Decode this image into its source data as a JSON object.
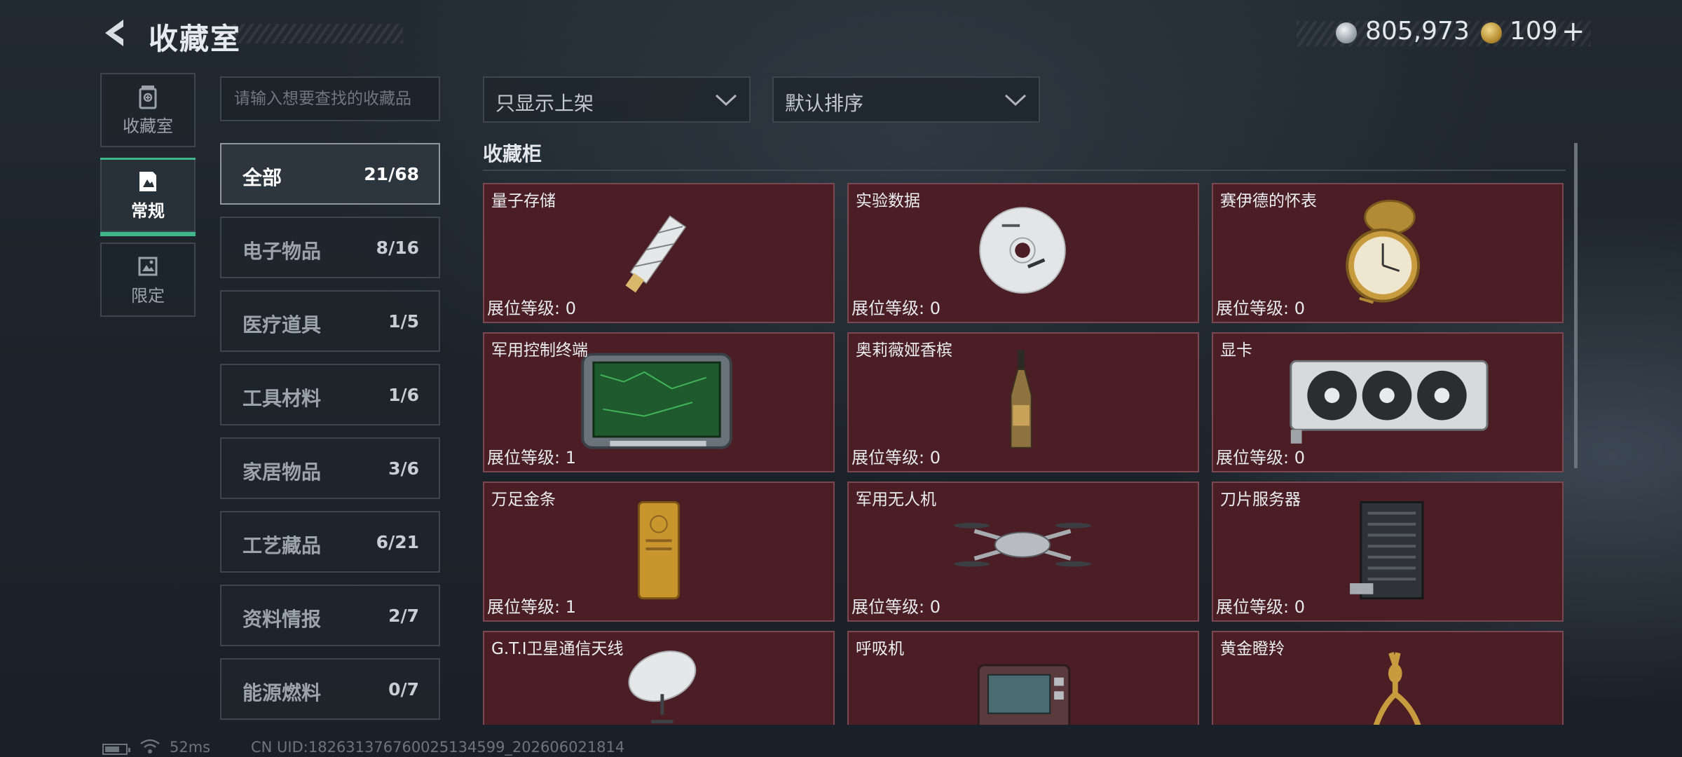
{
  "header": {
    "title": "收藏室",
    "currency": {
      "silver_value": "805,973",
      "gold_value": "109",
      "plus": "+"
    }
  },
  "side_tabs": [
    {
      "label": "收藏室",
      "icon": "trash-bin-icon"
    },
    {
      "label": "常规",
      "icon": "gallery-icon",
      "active": true
    },
    {
      "label": "限定",
      "icon": "landscape-icon"
    }
  ],
  "search": {
    "placeholder": "请输入想要查找的收藏品"
  },
  "categories": [
    {
      "name": "全部",
      "count": "21/68",
      "active": true
    },
    {
      "name": "电子物品",
      "count": "8/16"
    },
    {
      "name": "医疗道具",
      "count": "1/5"
    },
    {
      "name": "工具材料",
      "count": "1/6"
    },
    {
      "name": "家居物品",
      "count": "3/6"
    },
    {
      "name": "工艺藏品",
      "count": "6/21"
    },
    {
      "name": "资料情报",
      "count": "2/7"
    },
    {
      "name": "能源燃料",
      "count": "0/7"
    }
  ],
  "filters": {
    "display_filter": "只显示上架",
    "sort": "默认排序"
  },
  "section_title": "收藏柜",
  "level_prefix": "展位等级: ",
  "items": [
    {
      "name": "量子存储",
      "level": "展位等级: 0",
      "icon": "usb-drive-icon"
    },
    {
      "name": "实验数据",
      "level": "展位等级: 0",
      "icon": "disc-icon"
    },
    {
      "name": "赛伊德的怀表",
      "level": "展位等级: 0",
      "icon": "pocket-watch-icon"
    },
    {
      "name": "军用控制终端",
      "level": "展位等级: 1",
      "icon": "control-terminal-icon"
    },
    {
      "name": "奥莉薇娅香槟",
      "level": "展位等级: 0",
      "icon": "champagne-icon"
    },
    {
      "name": "显卡",
      "level": "展位等级: 0",
      "icon": "graphics-card-icon"
    },
    {
      "name": "万足金条",
      "level": "展位等级: 1",
      "icon": "gold-bar-icon"
    },
    {
      "name": "军用无人机",
      "level": "展位等级: 0",
      "icon": "drone-icon"
    },
    {
      "name": "刀片服务器",
      "level": "展位等级: 0",
      "icon": "server-icon"
    },
    {
      "name": "G.T.I卫星通信天线",
      "level": "",
      "icon": "satellite-dish-icon"
    },
    {
      "name": "呼吸机",
      "level": "",
      "icon": "ventilator-icon"
    },
    {
      "name": "黄金瞪羚",
      "level": "",
      "icon": "gazelle-statue-icon"
    }
  ],
  "status_bar": {
    "ping": "52ms",
    "uid": "CN UID:1826313767600251345​99_202606021814",
    "battery_level": 0.7
  }
}
